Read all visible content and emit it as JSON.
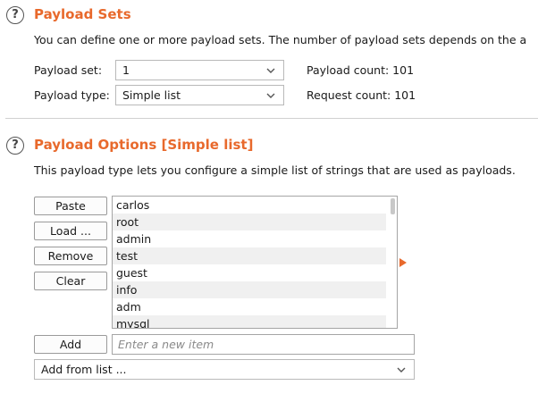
{
  "payload_sets": {
    "title": "Payload Sets",
    "description": "You can define one or more payload sets. The number of payload sets depends on the a",
    "set_label": "Payload set:",
    "set_value": "1",
    "type_label": "Payload type:",
    "type_value": "Simple list",
    "payload_count": "Payload count:  101",
    "request_count": "Request count:  101"
  },
  "payload_options": {
    "title": "Payload Options [Simple list]",
    "description": "This payload type lets you configure a simple list of strings that are used as payloads.",
    "buttons": {
      "paste": "Paste",
      "load": "Load ...",
      "remove": "Remove",
      "clear": "Clear",
      "add": "Add"
    },
    "items": [
      "carlos",
      "root",
      "admin",
      "test",
      "guest",
      "info",
      "adm",
      "mysql"
    ],
    "new_item_placeholder": "Enter a new item",
    "add_from_list": "Add from list ..."
  },
  "colors": {
    "accent": "#e8692c"
  }
}
